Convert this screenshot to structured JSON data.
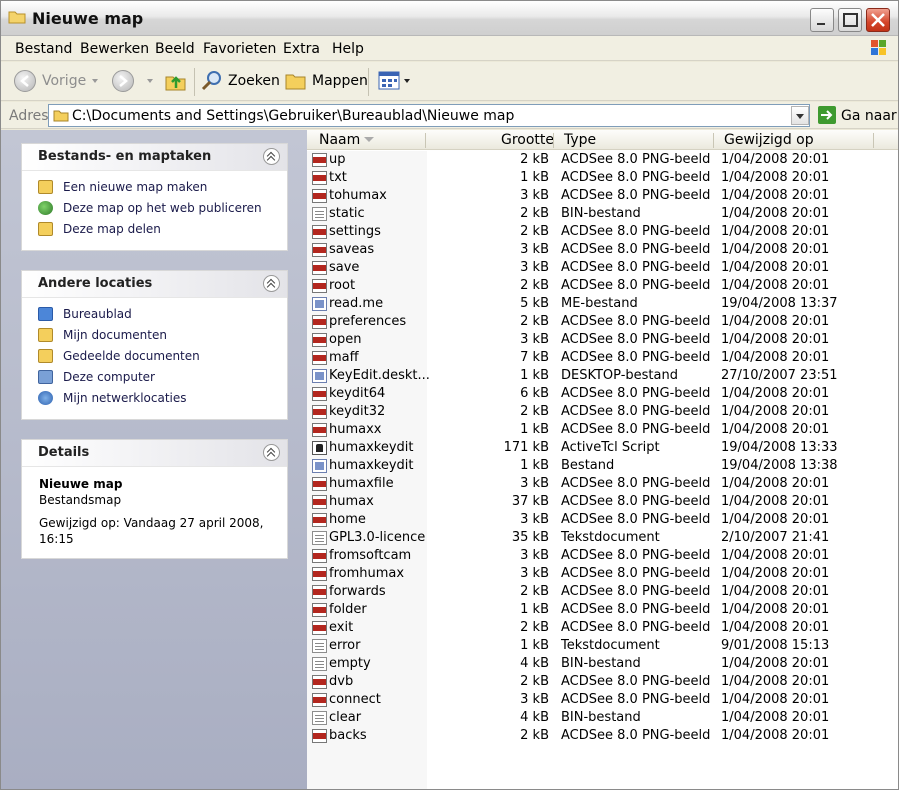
{
  "window": {
    "title": "Nieuwe map"
  },
  "menu": [
    "Bestand",
    "Bewerken",
    "Beeld",
    "Favorieten",
    "Extra",
    "Help"
  ],
  "toolbar": {
    "back_label": "Vorige",
    "search_label": "Zoeken",
    "folders_label": "Mappen"
  },
  "address": {
    "label": "Adres",
    "path": "C:\\Documents and Settings\\Gebruiker\\Bureaublad\\Nieuwe map",
    "go_label": "Ga naar"
  },
  "panels": {
    "tasks": {
      "title": "Bestands- en maptaken",
      "items": [
        "Een nieuwe map maken",
        "Deze map op het web publiceren",
        "Deze map delen"
      ]
    },
    "places": {
      "title": "Andere locaties",
      "items": [
        "Bureaublad",
        "Mijn documenten",
        "Gedeelde documenten",
        "Deze computer",
        "Mijn netwerklocaties"
      ]
    },
    "details": {
      "title": "Details",
      "name": "Nieuwe map",
      "type": "Bestandsmap",
      "modified": "Gewijzigd op: Vandaag 27 april 2008, 16:15"
    }
  },
  "columns": {
    "name": "Naam",
    "size": "Grootte",
    "type": "Type",
    "modified": "Gewijzigd op"
  },
  "files": [
    {
      "name": "up",
      "size": "2 kB",
      "type": "ACDSee 8.0 PNG-beeld",
      "date": "1/04/2008 20:01",
      "icon": "png"
    },
    {
      "name": "txt",
      "size": "1 kB",
      "type": "ACDSee 8.0 PNG-beeld",
      "date": "1/04/2008 20:01",
      "icon": "png"
    },
    {
      "name": "tohumax",
      "size": "3 kB",
      "type": "ACDSee 8.0 PNG-beeld",
      "date": "1/04/2008 20:01",
      "icon": "png"
    },
    {
      "name": "static",
      "size": "2 kB",
      "type": "BIN-bestand",
      "date": "1/04/2008 20:01",
      "icon": "doc"
    },
    {
      "name": "settings",
      "size": "2 kB",
      "type": "ACDSee 8.0 PNG-beeld",
      "date": "1/04/2008 20:01",
      "icon": "png"
    },
    {
      "name": "saveas",
      "size": "3 kB",
      "type": "ACDSee 8.0 PNG-beeld",
      "date": "1/04/2008 20:01",
      "icon": "png"
    },
    {
      "name": "save",
      "size": "3 kB",
      "type": "ACDSee 8.0 PNG-beeld",
      "date": "1/04/2008 20:01",
      "icon": "png"
    },
    {
      "name": "root",
      "size": "2 kB",
      "type": "ACDSee 8.0 PNG-beeld",
      "date": "1/04/2008 20:01",
      "icon": "png"
    },
    {
      "name": "read.me",
      "size": "5 kB",
      "type": "ME-bestand",
      "date": "19/04/2008 13:37",
      "icon": "sys"
    },
    {
      "name": "preferences",
      "size": "2 kB",
      "type": "ACDSee 8.0 PNG-beeld",
      "date": "1/04/2008 20:01",
      "icon": "png"
    },
    {
      "name": "open",
      "size": "3 kB",
      "type": "ACDSee 8.0 PNG-beeld",
      "date": "1/04/2008 20:01",
      "icon": "png"
    },
    {
      "name": "maff",
      "size": "7 kB",
      "type": "ACDSee 8.0 PNG-beeld",
      "date": "1/04/2008 20:01",
      "icon": "png"
    },
    {
      "name": "KeyEdit.deskt...",
      "size": "1 kB",
      "type": "DESKTOP-bestand",
      "date": "27/10/2007 23:51",
      "icon": "sys"
    },
    {
      "name": "keydit64",
      "size": "6 kB",
      "type": "ACDSee 8.0 PNG-beeld",
      "date": "1/04/2008 20:01",
      "icon": "png"
    },
    {
      "name": "keydit32",
      "size": "2 kB",
      "type": "ACDSee 8.0 PNG-beeld",
      "date": "1/04/2008 20:01",
      "icon": "png"
    },
    {
      "name": "humaxx",
      "size": "1 kB",
      "type": "ACDSee 8.0 PNG-beeld",
      "date": "1/04/2008 20:01",
      "icon": "png"
    },
    {
      "name": "humaxkeydit",
      "size": "171 kB",
      "type": "ActiveTcl Script",
      "date": "19/04/2008 13:33",
      "icon": "tcl"
    },
    {
      "name": "humaxkeydit",
      "size": "1 kB",
      "type": "Bestand",
      "date": "19/04/2008 13:38",
      "icon": "sys"
    },
    {
      "name": "humaxfile",
      "size": "3 kB",
      "type": "ACDSee 8.0 PNG-beeld",
      "date": "1/04/2008 20:01",
      "icon": "png"
    },
    {
      "name": "humax",
      "size": "37 kB",
      "type": "ACDSee 8.0 PNG-beeld",
      "date": "1/04/2008 20:01",
      "icon": "png"
    },
    {
      "name": "home",
      "size": "3 kB",
      "type": "ACDSee 8.0 PNG-beeld",
      "date": "1/04/2008 20:01",
      "icon": "png"
    },
    {
      "name": "GPL3.0-licence",
      "size": "35 kB",
      "type": "Tekstdocument",
      "date": "2/10/2007 21:41",
      "icon": "doc"
    },
    {
      "name": "fromsoftcam",
      "size": "3 kB",
      "type": "ACDSee 8.0 PNG-beeld",
      "date": "1/04/2008 20:01",
      "icon": "png"
    },
    {
      "name": "fromhumax",
      "size": "3 kB",
      "type": "ACDSee 8.0 PNG-beeld",
      "date": "1/04/2008 20:01",
      "icon": "png"
    },
    {
      "name": "forwards",
      "size": "2 kB",
      "type": "ACDSee 8.0 PNG-beeld",
      "date": "1/04/2008 20:01",
      "icon": "png"
    },
    {
      "name": "folder",
      "size": "1 kB",
      "type": "ACDSee 8.0 PNG-beeld",
      "date": "1/04/2008 20:01",
      "icon": "png"
    },
    {
      "name": "exit",
      "size": "2 kB",
      "type": "ACDSee 8.0 PNG-beeld",
      "date": "1/04/2008 20:01",
      "icon": "png"
    },
    {
      "name": "error",
      "size": "1 kB",
      "type": "Tekstdocument",
      "date": "9/01/2008 15:13",
      "icon": "doc"
    },
    {
      "name": "empty",
      "size": "4 kB",
      "type": "BIN-bestand",
      "date": "1/04/2008 20:01",
      "icon": "doc"
    },
    {
      "name": "dvb",
      "size": "2 kB",
      "type": "ACDSee 8.0 PNG-beeld",
      "date": "1/04/2008 20:01",
      "icon": "png"
    },
    {
      "name": "connect",
      "size": "3 kB",
      "type": "ACDSee 8.0 PNG-beeld",
      "date": "1/04/2008 20:01",
      "icon": "png"
    },
    {
      "name": "clear",
      "size": "4 kB",
      "type": "BIN-bestand",
      "date": "1/04/2008 20:01",
      "icon": "doc"
    },
    {
      "name": "backs",
      "size": "2 kB",
      "type": "ACDSee 8.0 PNG-beeld",
      "date": "1/04/2008 20:01",
      "icon": "png"
    }
  ]
}
